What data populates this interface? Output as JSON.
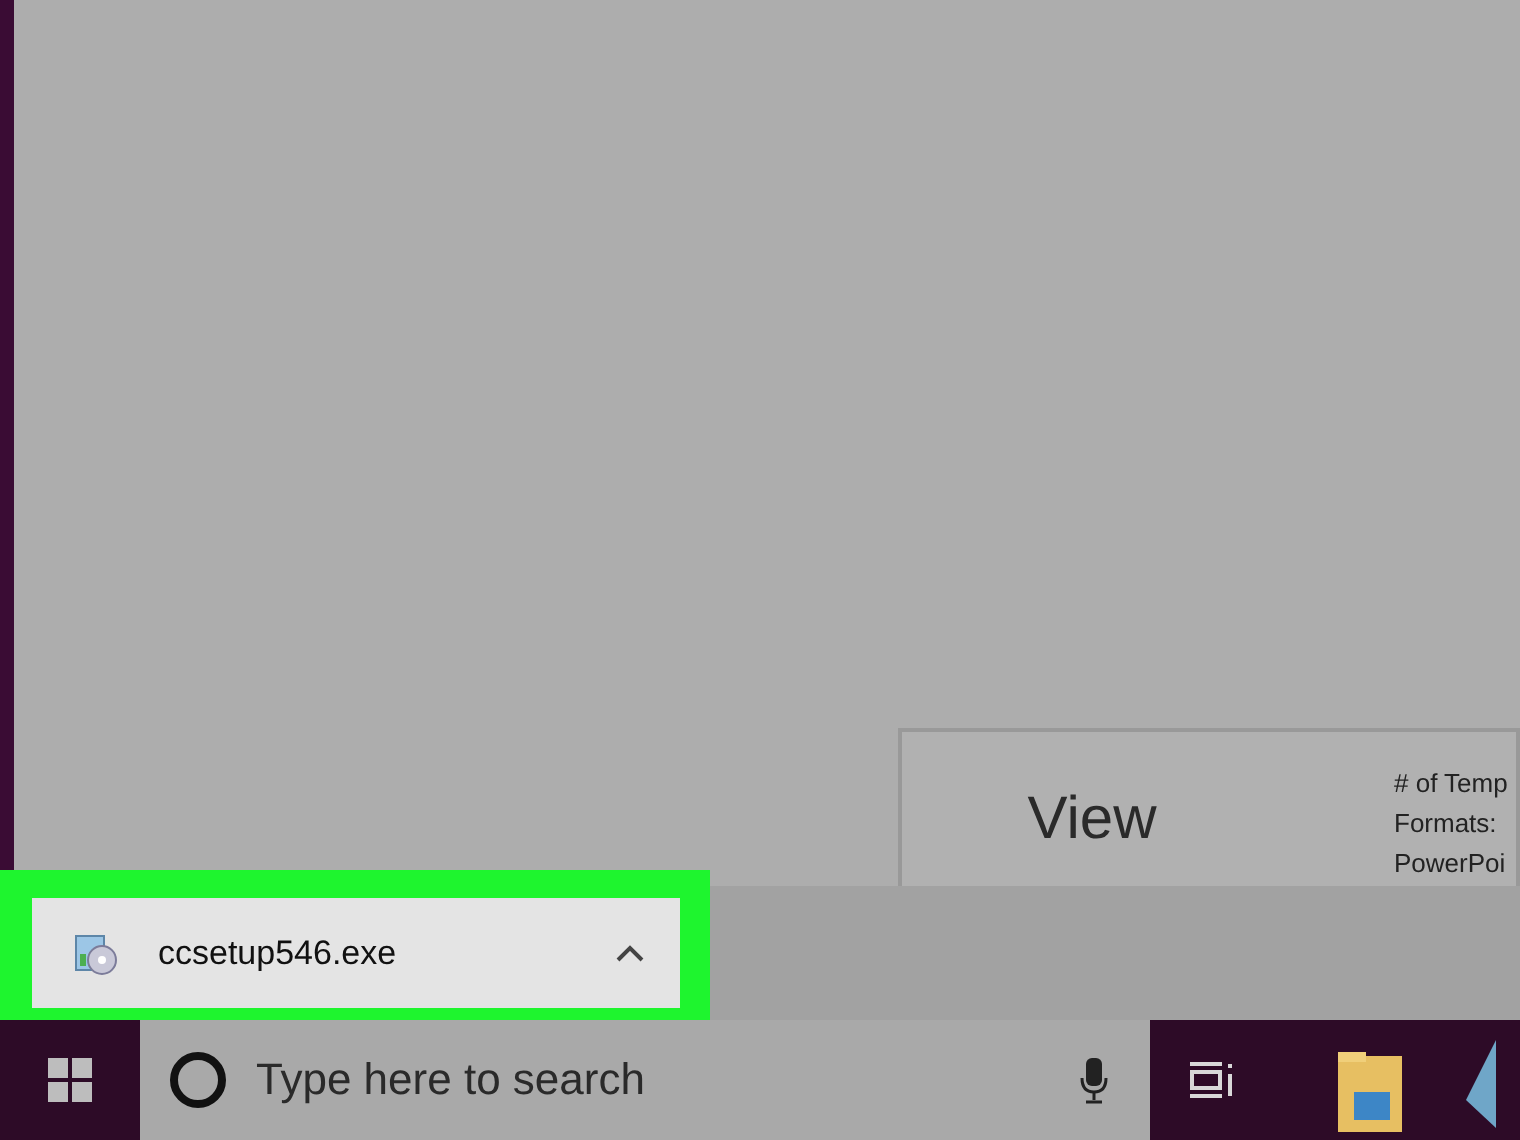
{
  "document_card": {
    "title": "View",
    "details": [
      "# of Temp",
      "Formats:",
      "PowerPoi"
    ]
  },
  "download_bar": {
    "items": [
      {
        "file_name": "ccsetup546.exe",
        "highlighted": true
      }
    ]
  },
  "taskbar": {
    "search": {
      "placeholder": "Type here to search"
    }
  }
}
